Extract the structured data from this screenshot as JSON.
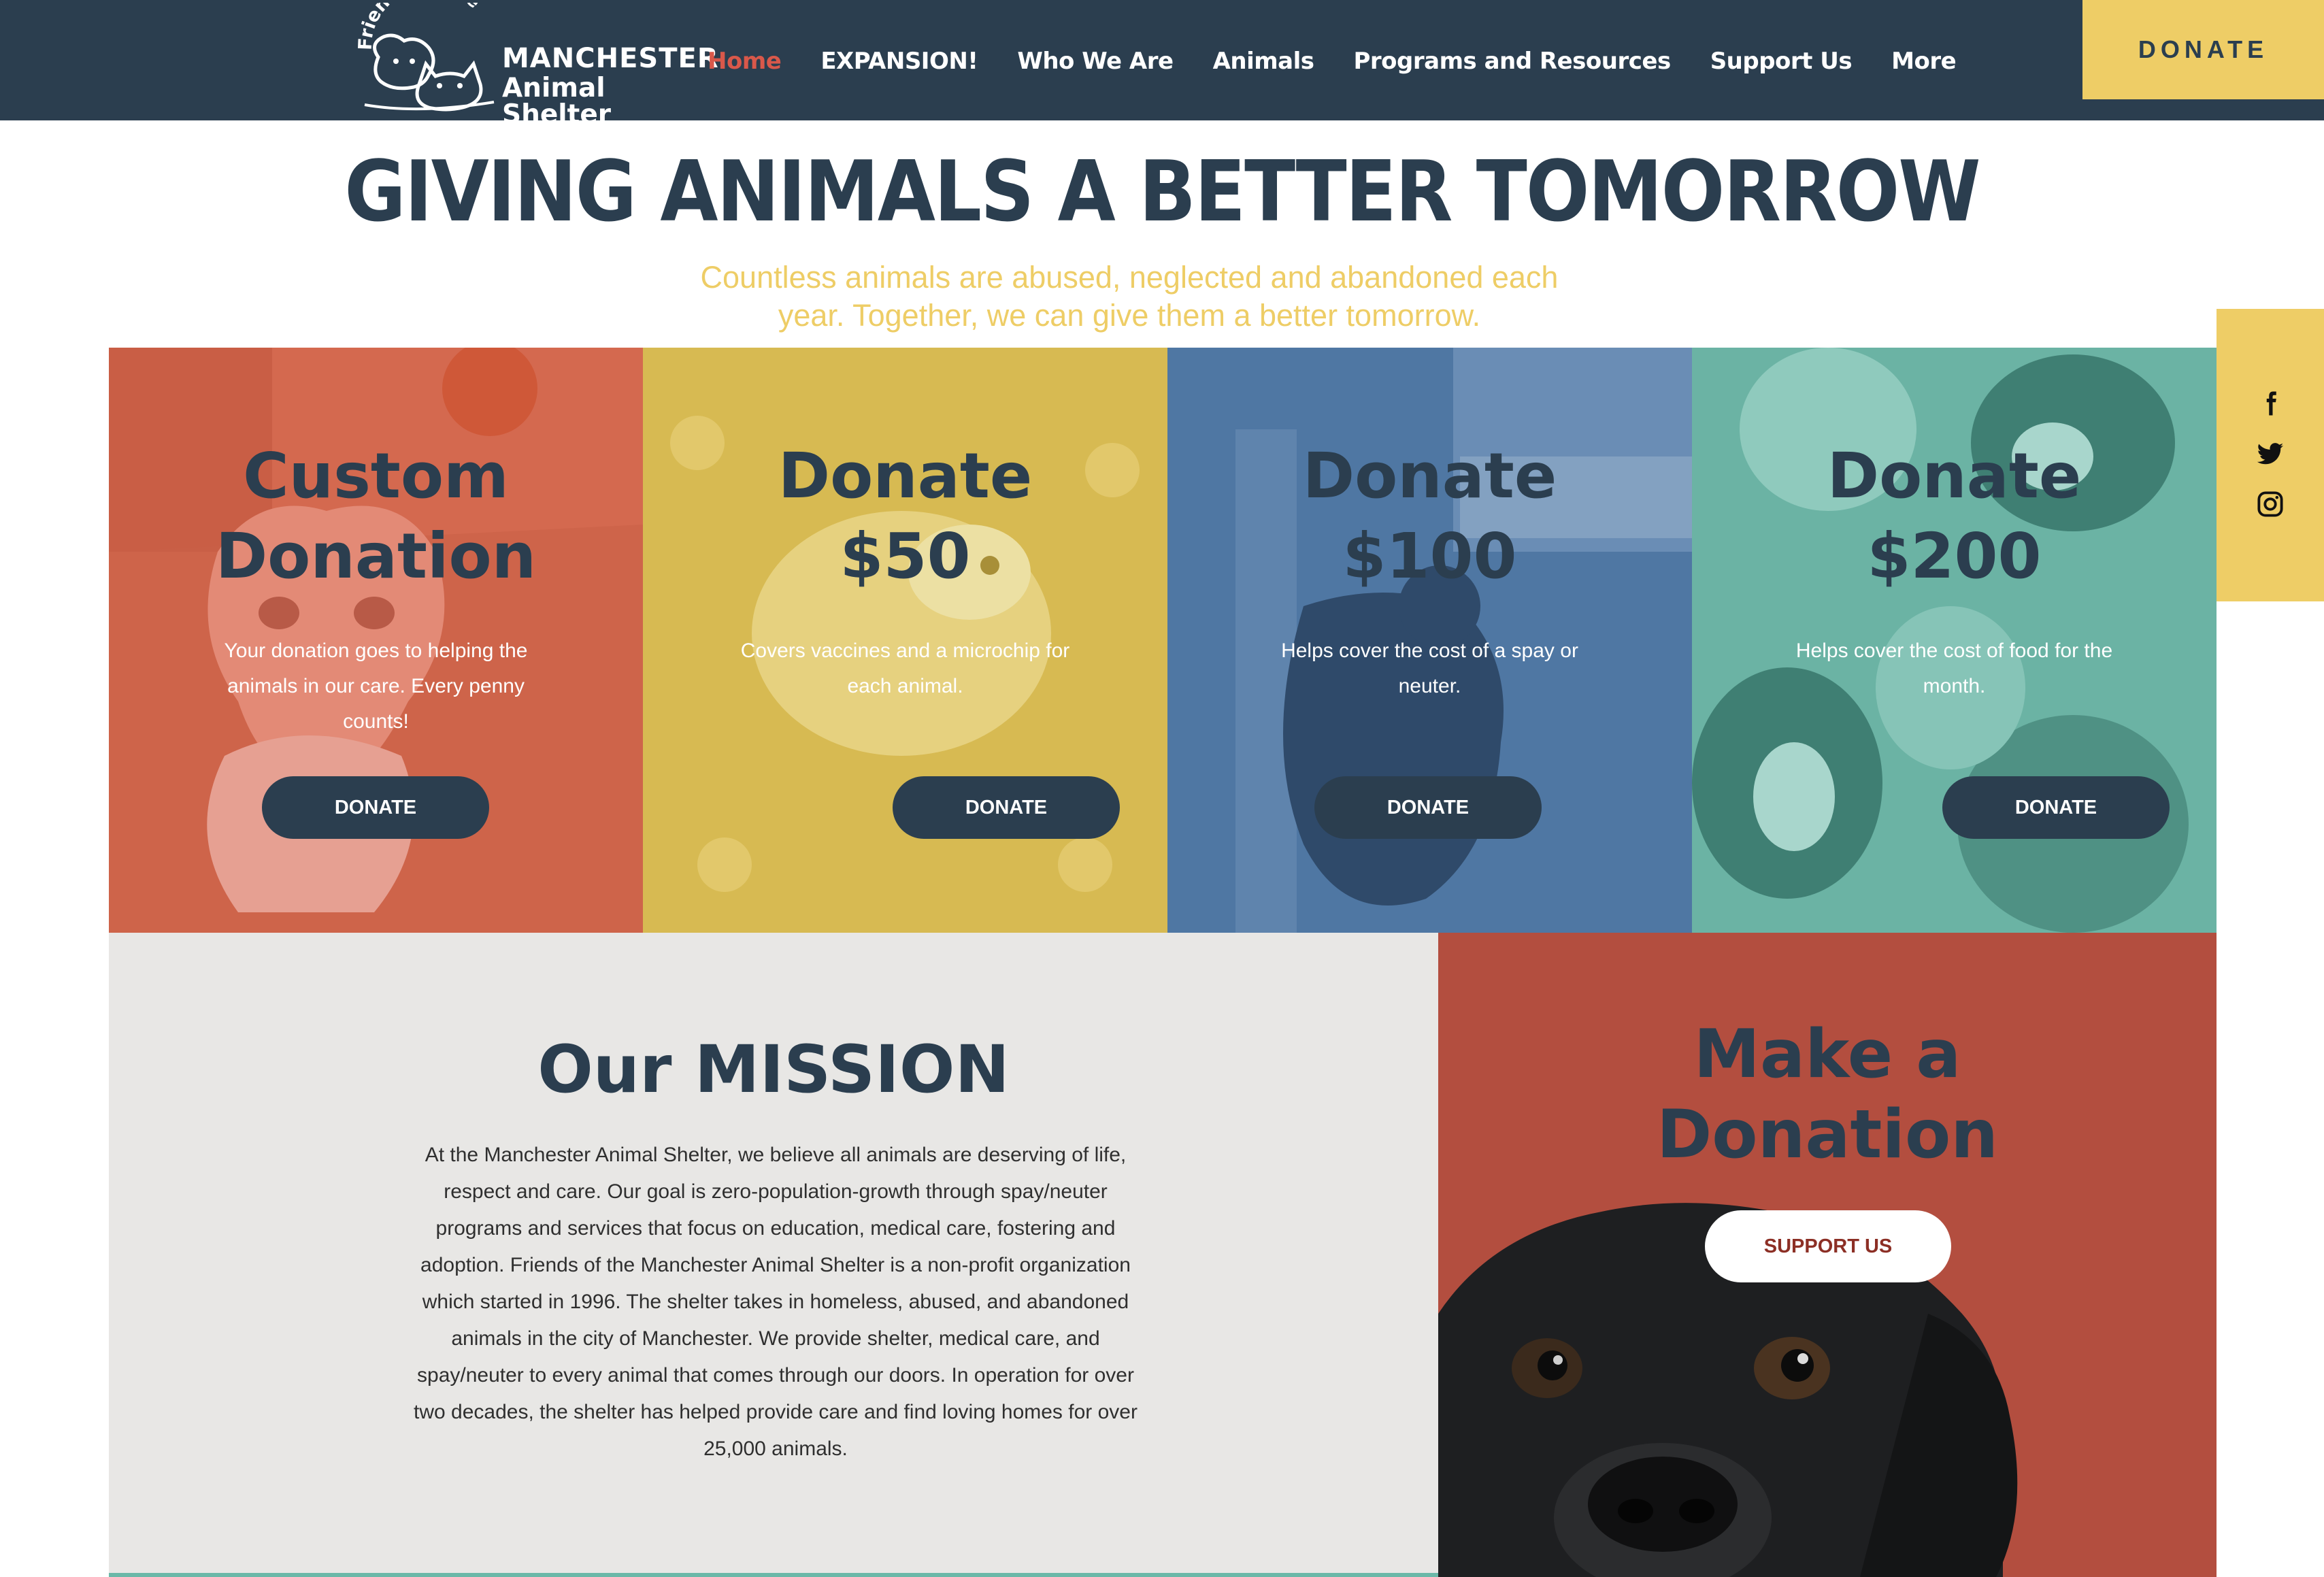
{
  "header": {
    "logo": {
      "arc_text": "Friends of the",
      "line1": "MANCHESTER",
      "line2": "Animal Shelter"
    },
    "nav": [
      {
        "label": "Home",
        "active": true
      },
      {
        "label": "EXPANSION!",
        "active": false
      },
      {
        "label": "Who We Are",
        "active": false
      },
      {
        "label": "Animals",
        "active": false
      },
      {
        "label": "Programs and Resources",
        "active": false
      },
      {
        "label": "Support Us",
        "active": false
      },
      {
        "label": "More",
        "active": false
      }
    ],
    "donate_label": "DONATE"
  },
  "hero": {
    "title": "GIVING ANIMALS A BETTER TOMORROW",
    "subtitle": "Countless animals are abused, neglected and abandoned each year. Together, we can give them a better tomorrow."
  },
  "social": [
    "facebook-icon",
    "twitter-icon",
    "instagram-icon"
  ],
  "cards": [
    {
      "title_line1": "Custom",
      "title_line2": "Donation",
      "text": "Your donation goes to helping the animals in our care. Every penny counts!",
      "button": "DONATE",
      "color": "#d4694f"
    },
    {
      "title_line1": "Donate",
      "title_line2": "$50",
      "text": "Covers vaccines and a microchip for each animal.",
      "button": "DONATE",
      "color": "#d9bd55"
    },
    {
      "title_line1": "Donate",
      "title_line2": "$100",
      "text": "Helps cover the cost of a spay or neuter.",
      "button": "DONATE",
      "color": "#4f77a3"
    },
    {
      "title_line1": "Donate",
      "title_line2": "$200",
      "text": "Helps cover the cost of food for the month.",
      "button": "DONATE",
      "color": "#6bb3a4"
    }
  ],
  "mission": {
    "title": "Our MISSION",
    "body": "At the Manchester Animal Shelter, we believe all animals are deserving of life, respect and care. Our goal is zero-population-growth through spay/neuter programs and services that focus on education, medical care, fostering and adoption. Friends of the Manchester Animal Shelter is a non-profit organization which started in 1996. The shelter takes in homeless, abused, and abandoned animals in the city of Manchester. We provide shelter, medical care, and spay/neuter to every animal that comes through our doors. In operation for over two decades, the shelter has helped provide care and find loving homes for over 25,000 animals."
  },
  "make_donation": {
    "title_line1": "Make a",
    "title_line2": "Donation",
    "button": "SUPPORT US"
  },
  "colors": {
    "navy": "#2b3e4f",
    "yellow": "#eecd66",
    "active_nav": "#d9584a",
    "brick": "#b34e3f"
  }
}
